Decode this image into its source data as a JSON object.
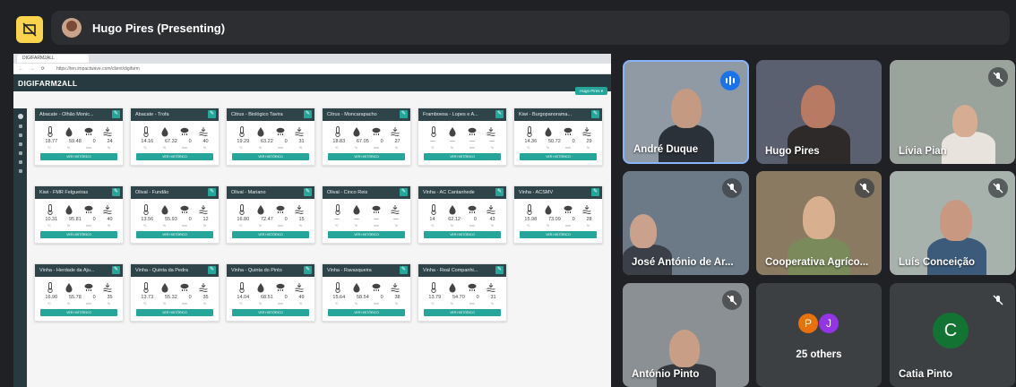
{
  "meet": {
    "presenter_label": "Hugo Pires (Presenting)"
  },
  "browser": {
    "tab_title": "DIGIFARM2ALL",
    "url": "https://ten.impactwave.com/client/digifarm"
  },
  "app": {
    "logo": "DIGIFARM2ALL",
    "user_button": "Hugo Pires ▾",
    "unit_labels": [
      "ºC",
      "%",
      "mm",
      "%"
    ],
    "history_button": "VER HISTÓRICO"
  },
  "cards": [
    {
      "title": "Abacate - Olhão Monic...",
      "values": [
        "18.77",
        "59.48",
        "0",
        "24"
      ]
    },
    {
      "title": "Abacate - Trofa",
      "values": [
        "14.16",
        "67.32",
        "0",
        "40"
      ]
    },
    {
      "title": "Citrus - Biológico Tavira",
      "values": [
        "19.29",
        "63.22",
        "0",
        "31"
      ]
    },
    {
      "title": "Citrus - Moncarapacho",
      "values": [
        "18.83",
        "67.05",
        "0",
        "27"
      ]
    },
    {
      "title": "Framboesa - Lopes e A...",
      "values": [
        "—",
        "—",
        "—",
        "—"
      ]
    },
    {
      "title": "Kiwi - Burgopanorama...",
      "values": [
        "14.36",
        "50.72",
        "0",
        "29"
      ]
    },
    {
      "title": "Kiwi - FMR Felgueiras",
      "values": [
        "10.31",
        "95.81",
        "0",
        "40"
      ]
    },
    {
      "title": "Olival - Fundão",
      "values": [
        "13.56",
        "55.93",
        "0",
        "12"
      ]
    },
    {
      "title": "Olival - Mariano",
      "values": [
        "16.80",
        "72.47",
        "0",
        "15"
      ]
    },
    {
      "title": "Olival - Cinco Reis",
      "values": [
        "—",
        "—",
        "—",
        "—"
      ]
    },
    {
      "title": "Vinha - AC Cantanhede",
      "values": [
        "14",
        "62.12",
        "0",
        "43"
      ]
    },
    {
      "title": "Vinha - ACSMV",
      "values": [
        "15.98",
        "73.09",
        "0",
        "28"
      ]
    },
    {
      "title": "Vinha - Herdade da Aju...",
      "values": [
        "16.90",
        "55.78",
        "0",
        "35"
      ]
    },
    {
      "title": "Vinha - Quinta da Pedra",
      "values": [
        "13.73",
        "55.32",
        "0",
        "35"
      ]
    },
    {
      "title": "Vinha - Quinta do Pinto",
      "values": [
        "14.04",
        "68.51",
        "0",
        "49"
      ]
    },
    {
      "title": "Vinha - Ravasqueira",
      "values": [
        "15.64",
        "58.54",
        "0",
        "38"
      ]
    },
    {
      "title": "Vinha - Real Companhi...",
      "values": [
        "13.79",
        "54.70",
        "0",
        "31"
      ]
    }
  ],
  "participants": [
    {
      "name": "André Duque"
    },
    {
      "name": "Hugo Pires"
    },
    {
      "name": "Lívia Pian"
    },
    {
      "name": "José António de Ar..."
    },
    {
      "name": "Cooperativa Agríco..."
    },
    {
      "name": "Luís Conceição"
    },
    {
      "name": "António Pinto"
    },
    {
      "name": "Catia Pinto"
    }
  ],
  "others": {
    "label": "25 others",
    "avatars": [
      "P",
      "J"
    ]
  },
  "catia_initial": "C",
  "colors": {
    "accent_teal": "#26a69a",
    "header_dark": "#273a3f",
    "meet_bg": "#202124",
    "speaking_blue": "#1a73e8",
    "present_yellow": "#fcd34d"
  }
}
